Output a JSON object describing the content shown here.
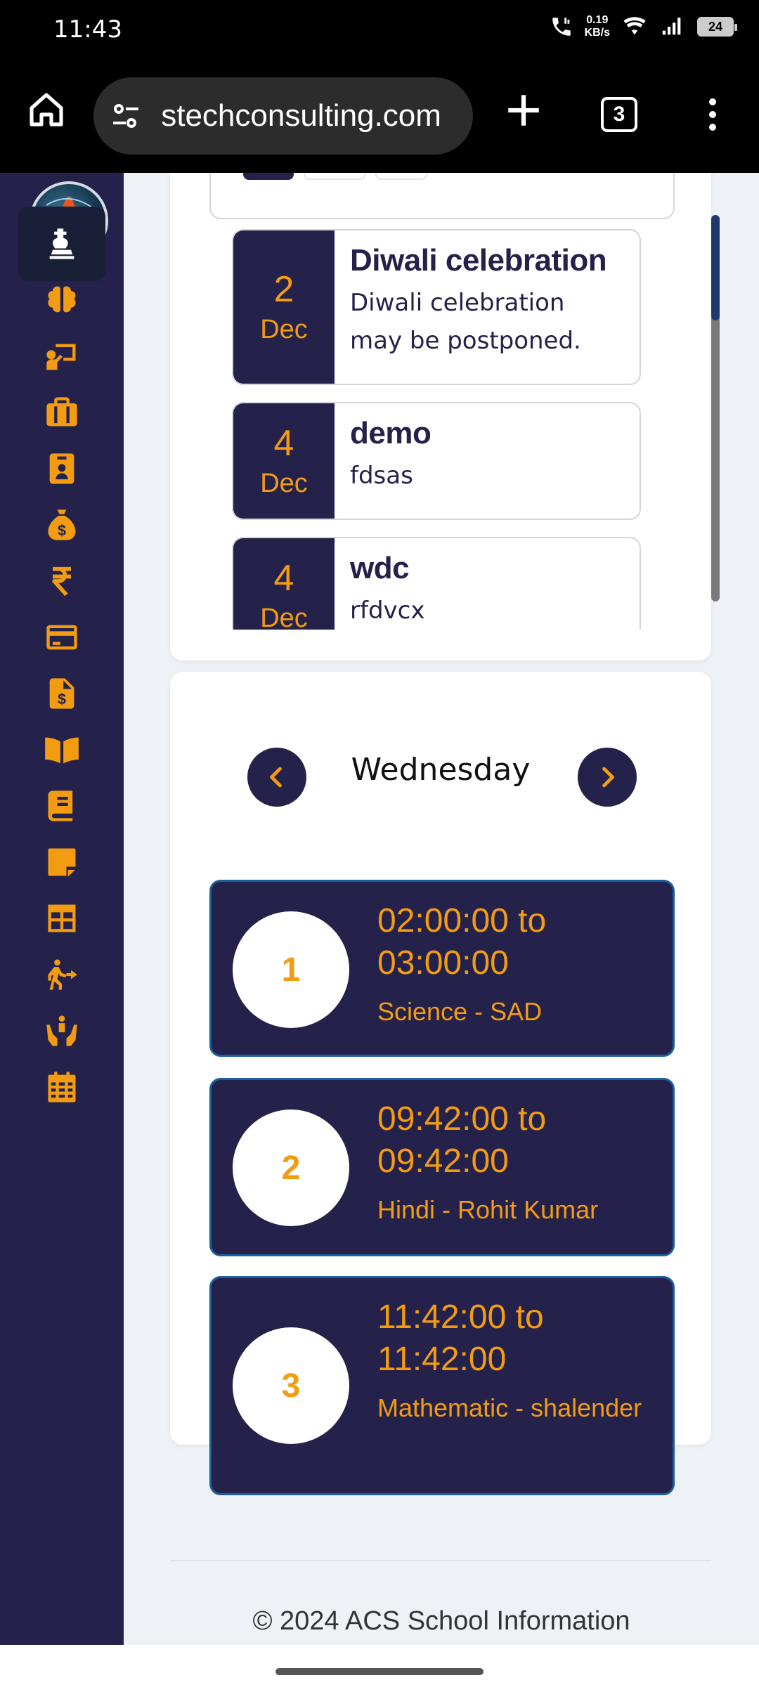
{
  "status_bar": {
    "time": "11:43",
    "speed": "0.19",
    "speed_unit": "KB/s",
    "battery": "24"
  },
  "browser": {
    "url": " stechconsulting.com",
    "tab_count": "3"
  },
  "sidebar": {
    "items": [
      {
        "icon": "chess-king-icon",
        "active": true
      },
      {
        "icon": "brain-icon"
      },
      {
        "icon": "teacher-icon"
      },
      {
        "icon": "briefcase-icon"
      },
      {
        "icon": "id-badge-icon"
      },
      {
        "icon": "money-bag-icon"
      },
      {
        "icon": "rupee-icon"
      },
      {
        "icon": "credit-card-icon"
      },
      {
        "icon": "invoice-icon"
      },
      {
        "icon": "open-book-icon"
      },
      {
        "icon": "book-icon"
      },
      {
        "icon": "sticky-note-icon"
      },
      {
        "icon": "table-icon"
      },
      {
        "icon": "person-walking-arrow-icon"
      },
      {
        "icon": "hands-holding-child-icon"
      },
      {
        "icon": "calendar-icon"
      }
    ],
    "accent": "#f39c12",
    "background": "#24214a"
  },
  "events": [
    {
      "day": "2",
      "month": "Dec",
      "title": "Diwali celebration",
      "description": "Diwali celebration may be postponed."
    },
    {
      "day": "4",
      "month": "Dec",
      "title": "demo",
      "description": "fdsas"
    },
    {
      "day": "4",
      "month": "Dec",
      "title": "wdc",
      "description": "rfdvcx"
    }
  ],
  "timetable": {
    "day": "Wednesday",
    "periods": [
      {
        "number": "1",
        "time": "02:00:00 to 03:00:00",
        "subject": "Science - SAD"
      },
      {
        "number": "2",
        "time": "09:42:00 to 09:42:00",
        "subject": "Hindi - Rohit Kumar"
      },
      {
        "number": "3",
        "time": "11:42:00 to 11:42:00",
        "subject": "Mathematic - shalender"
      }
    ]
  },
  "footer": {
    "text": "© 2024 ACS School Information"
  }
}
